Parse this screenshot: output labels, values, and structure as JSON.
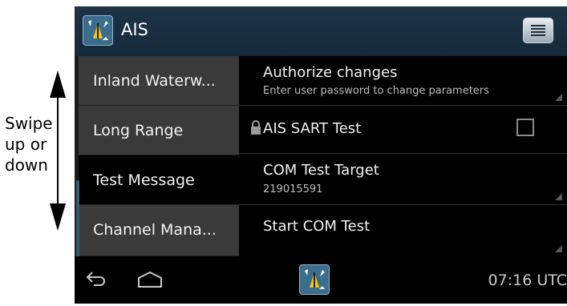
{
  "annotation": {
    "swipe_text": "Swipe up or down"
  },
  "actionbar": {
    "title": "AIS",
    "app_icon": "ais-radar-icon",
    "menu_icon": "menu-list-icon"
  },
  "left_menu": {
    "items": [
      {
        "label": "Inland Waterw..."
      },
      {
        "label": "Long Range"
      },
      {
        "label": "Test Message"
      },
      {
        "label": "Channel Mana..."
      }
    ],
    "active_index": 2
  },
  "settings": {
    "authorize": {
      "title": "Authorize changes",
      "subtitle": "Enter user password to change parameters"
    },
    "sart_test": {
      "title": "AIS SART Test",
      "checked": false,
      "icon": "lock-icon"
    },
    "com_target": {
      "title": "COM Test Target",
      "value": "219015591"
    },
    "start_com": {
      "title": "Start COM Test"
    }
  },
  "navbar": {
    "back_icon": "back-icon",
    "home_icon": "home-icon",
    "app_icon": "ais-radar-icon",
    "time": "07:16 UTC"
  },
  "colors": {
    "actionbar": "#1e3446",
    "accent": "#2e5d7a",
    "item_bg": "#3a3a3a",
    "active_bg": "#000000"
  }
}
